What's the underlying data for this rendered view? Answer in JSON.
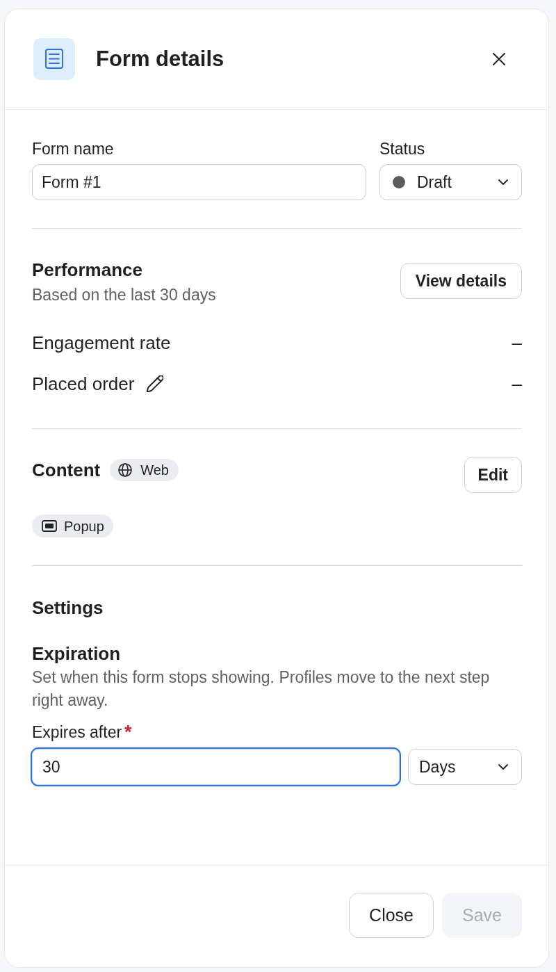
{
  "header": {
    "title": "Form details"
  },
  "form_name": {
    "label": "Form name",
    "value": "Form #1"
  },
  "status": {
    "label": "Status",
    "value": "Draft",
    "color": "#5c5c60"
  },
  "performance": {
    "title": "Performance",
    "subtitle": "Based on the last 30 days",
    "button": "View details",
    "metrics": [
      {
        "label": "Engagement rate",
        "value": "–",
        "editable": false
      },
      {
        "label": "Placed order",
        "value": "–",
        "editable": true
      }
    ]
  },
  "content": {
    "title": "Content",
    "channel": "Web",
    "button": "Edit",
    "tags": [
      {
        "label": "Popup"
      }
    ]
  },
  "settings": {
    "title": "Settings",
    "expiration": {
      "title": "Expiration",
      "description": "Set when this form stops showing. Profiles move to the next step right away.",
      "field": {
        "label": "Expires after",
        "required_mark": "*",
        "value": "30",
        "focused": true
      },
      "unit": "Days"
    }
  },
  "footer": {
    "buttons": [
      {
        "label": "Close",
        "disabled": false
      },
      {
        "label": "Save",
        "disabled": true
      }
    ]
  }
}
